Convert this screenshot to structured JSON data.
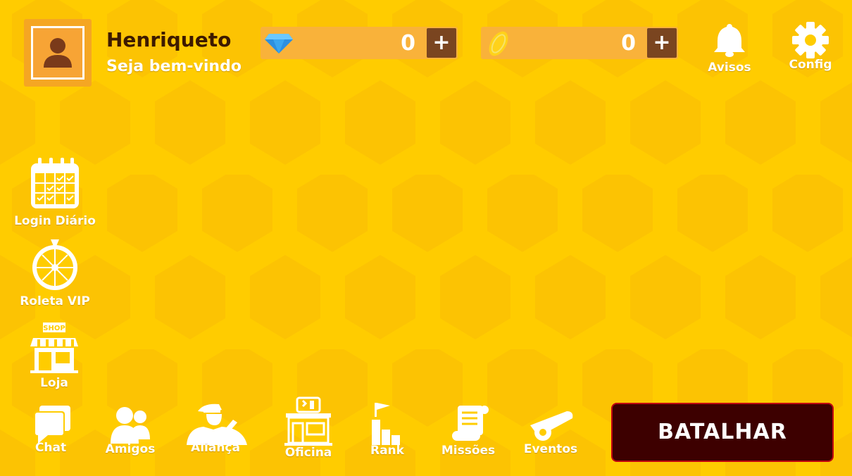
{
  "player": {
    "name": "Henriqueto",
    "greeting": "Seja bem-vindo"
  },
  "currencies": {
    "gems": {
      "value": "0",
      "plus": "+",
      "icon": "diamond-icon"
    },
    "coins": {
      "value": "0",
      "plus": "+",
      "icon": "coin-icon"
    }
  },
  "top_right": {
    "notices": "Avisos",
    "settings": "Config"
  },
  "left_menu": {
    "daily_login": "Login Diário",
    "vip_wheel": "Roleta VIP",
    "shop": "Loja",
    "shop_sign": "SHOP"
  },
  "bottom_nav": {
    "chat": "Chat",
    "friends": "Amigos",
    "alliance": "Aliança",
    "workshop": "Oficina",
    "rank": "Rank",
    "missions": "Missões",
    "events": "Eventos"
  },
  "battle_button": "BATALHAR",
  "colors": {
    "background": "#ffcc00",
    "hex_pattern": "#fcc203",
    "battle_bg": "#3d0000",
    "battle_border": "#c10010",
    "name_text": "#3d1a00"
  }
}
